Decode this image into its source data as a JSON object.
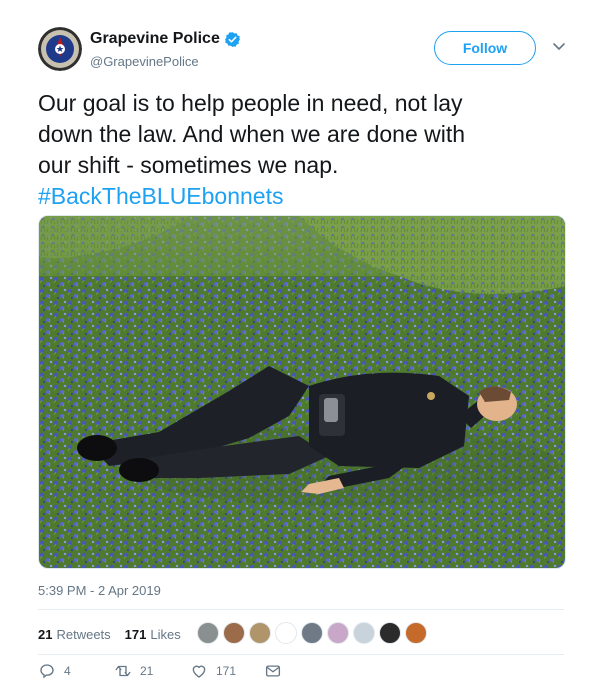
{
  "account": {
    "display_name": "Grapevine Police",
    "handle": "@GrapevinePolice",
    "verified": true,
    "follow_label": "Follow"
  },
  "tweet": {
    "lines": [
      "Our goal is to help people in need, not lay",
      "down the law. And when we are done with",
      "our shift - sometimes we nap."
    ],
    "hashtag": "#BackTheBLUEbonnets"
  },
  "timestamp": "5:39 PM - 2 Apr 2019",
  "stats": {
    "retweets_count": "21",
    "retweets_label": "Retweets",
    "likes_count": "171",
    "likes_label": "Likes"
  },
  "likers": [
    {
      "name": "liker-1",
      "color": "#8a8f8f"
    },
    {
      "name": "liker-2",
      "color": "#9b6b4a"
    },
    {
      "name": "liker-3",
      "color": "#b0946a"
    },
    {
      "name": "liker-4",
      "color": "#ffffff"
    },
    {
      "name": "liker-5",
      "color": "#6f7a86"
    },
    {
      "name": "liker-6",
      "color": "#c9a7c9"
    },
    {
      "name": "liker-7",
      "color": "#c9d3dc"
    },
    {
      "name": "liker-8",
      "color": "#2b2b2b"
    },
    {
      "name": "liker-9",
      "color": "#c66a2c"
    }
  ],
  "actions": {
    "reply_count": "4",
    "retweet_count": "21",
    "like_count": "171"
  },
  "colors": {
    "accent": "#1da1f2",
    "muted": "#657786",
    "text": "#14171a"
  }
}
